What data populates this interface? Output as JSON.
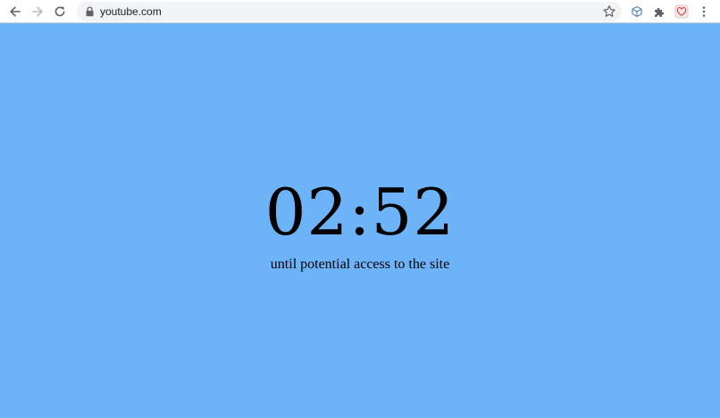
{
  "browser": {
    "url": "youtube.com",
    "icons": {
      "back": "back-arrow-icon",
      "forward": "forward-arrow-icon",
      "reload": "reload-icon",
      "lock": "lock-icon",
      "bookmark": "star-icon",
      "extension_1": "cube-extension-icon",
      "extensions_menu": "puzzle-piece-icon",
      "extension_2": "red-heart-extension-icon",
      "menu": "kebab-menu-icon"
    }
  },
  "page": {
    "background_color": "#6db3f7",
    "timer": "02:52",
    "caption": "until potential access to the site"
  }
}
